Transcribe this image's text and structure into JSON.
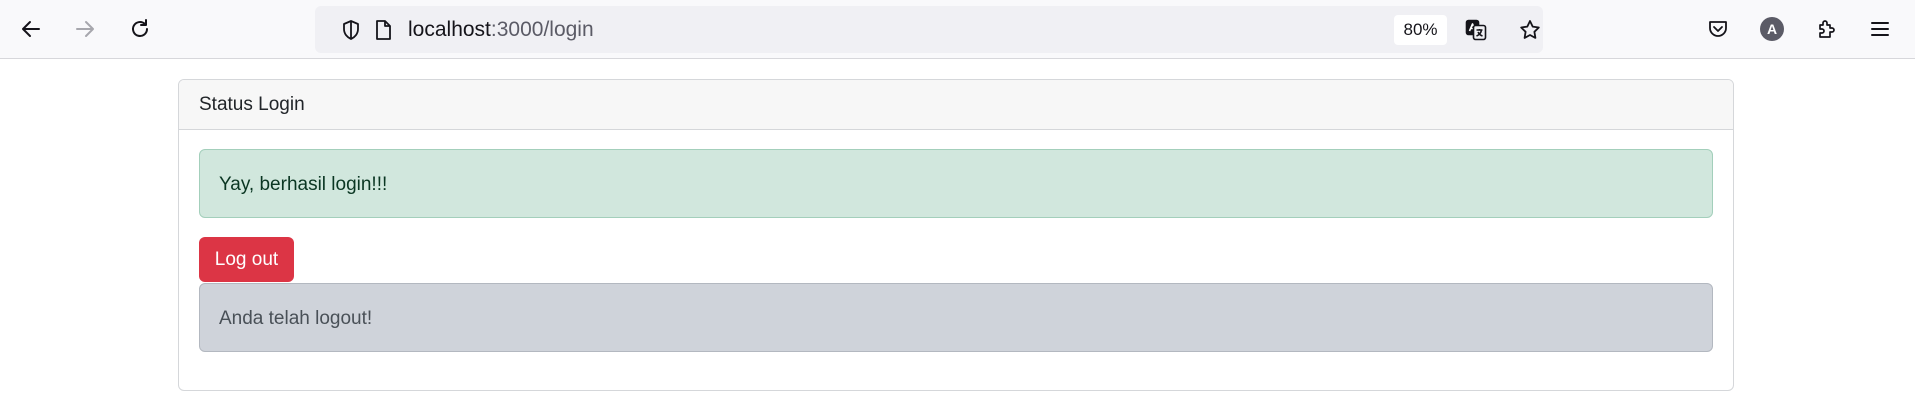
{
  "browser": {
    "url_host": "localhost",
    "url_path": ":3000/login",
    "zoom": "80%",
    "profile_initial": "A",
    "icons": {
      "back": "arrow-left-icon",
      "forward": "arrow-right-icon",
      "reload": "reload-icon",
      "tracking": "shield-icon",
      "page": "page-icon",
      "translate": "translate-icon",
      "bookmark": "star-icon",
      "pocket": "pocket-icon",
      "extensions": "puzzle-icon",
      "menu": "hamburger-menu-icon"
    }
  },
  "card": {
    "header": "Status Login",
    "success_message": "Yay, berhasil login!!!",
    "logout_label": "Log out",
    "logout_message": "Anda telah logout!"
  },
  "colors": {
    "danger": "#dc3545",
    "success_bg": "#d1e7dd",
    "secondary_bg": "#cfd3da"
  }
}
